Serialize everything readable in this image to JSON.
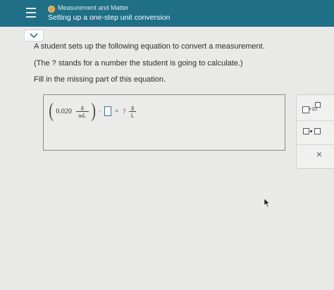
{
  "header": {
    "topic": "Measurement and Matter",
    "title": "Setting up a one-step unit conversion",
    "topic_dot_color": "#e0a33a",
    "background_color": "#1f6f87"
  },
  "question": {
    "line1": "A student sets up the following equation to convert a measurement.",
    "line2": "(The ? stands for a number the student is going to calculate.)",
    "line3": "Fill in the missing part of this equation."
  },
  "equation": {
    "coefficient": "0.020",
    "frac1_num": "g",
    "frac1_den": "mL",
    "dot": "·",
    "equals": "=",
    "unknown": "?",
    "frac2_num": "g",
    "frac2_den": "L"
  },
  "tools": {
    "sci_notation_label": "×10",
    "close_label": "×"
  },
  "icons": {
    "menu": "hamburger-menu-icon",
    "collapse": "chevron-down-icon",
    "close": "close-icon",
    "cursor": "mouse-cursor-icon"
  }
}
